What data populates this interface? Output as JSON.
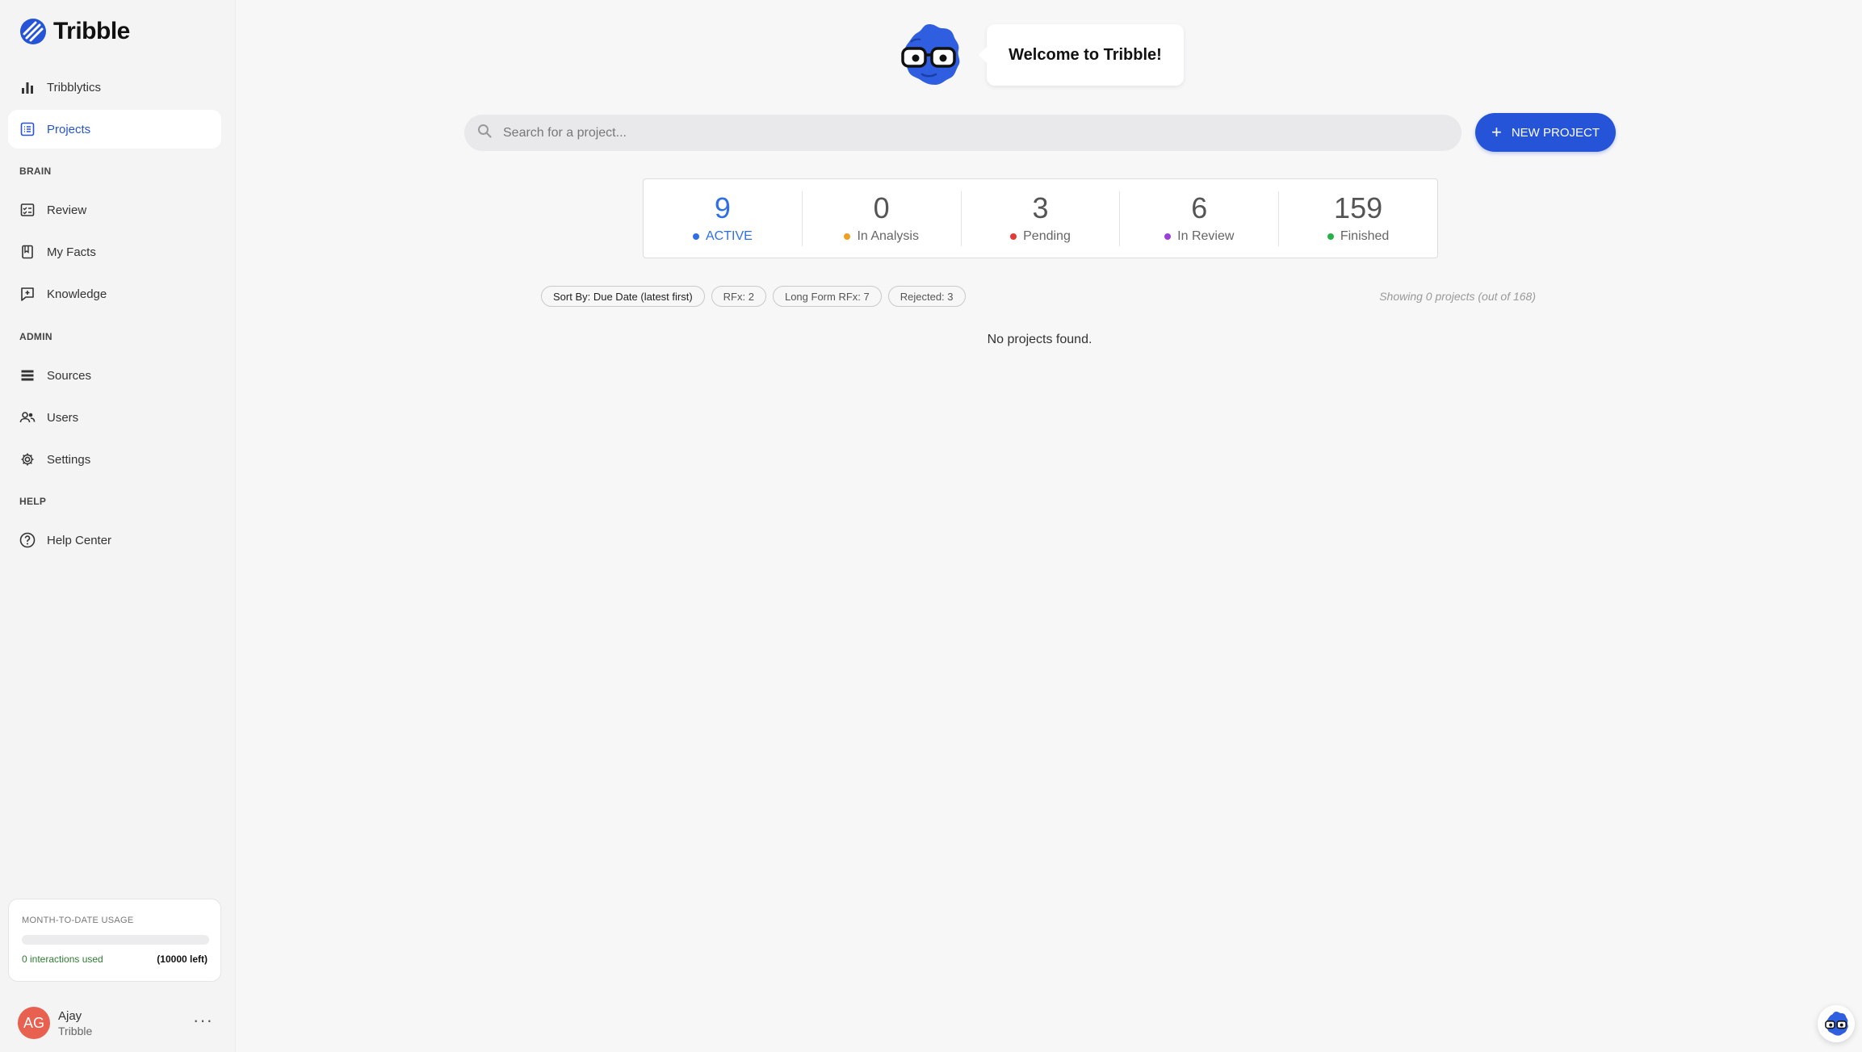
{
  "app": {
    "name": "Tribble"
  },
  "sidebar": {
    "nav_top": [
      {
        "label": "Tribblytics",
        "icon": "bar-chart-icon"
      },
      {
        "label": "Projects",
        "icon": "list-icon",
        "active": true
      }
    ],
    "sections": {
      "brain": "BRAIN",
      "admin": "ADMIN",
      "help": "HELP"
    },
    "brain_items": [
      {
        "label": "Review",
        "icon": "checklist-icon"
      },
      {
        "label": "My Facts",
        "icon": "book-icon"
      },
      {
        "label": "Knowledge",
        "icon": "plus-square-icon"
      }
    ],
    "admin_items": [
      {
        "label": "Sources",
        "icon": "stack-icon"
      },
      {
        "label": "Users",
        "icon": "users-icon"
      },
      {
        "label": "Settings",
        "icon": "gear-icon"
      }
    ],
    "help_items": [
      {
        "label": "Help Center",
        "icon": "help-circle-icon"
      }
    ],
    "usage": {
      "title": "MONTH-TO-DATE USAGE",
      "used_label": "0 interactions used",
      "left_label": "(10000 left)",
      "progress": 0
    },
    "user": {
      "initials": "AG",
      "name": "Ajay",
      "org": "Tribble",
      "more": "···"
    }
  },
  "header": {
    "welcome": "Welcome to Tribble!"
  },
  "search": {
    "placeholder": "Search for a project..."
  },
  "new_project_button": {
    "label": "NEW PROJECT"
  },
  "stats": [
    {
      "value": "9",
      "label": "ACTIVE",
      "color": "#2f6fe6"
    },
    {
      "value": "0",
      "label": "In Analysis",
      "color": "#f0a020"
    },
    {
      "value": "3",
      "label": "Pending",
      "color": "#e53935"
    },
    {
      "value": "6",
      "label": "In Review",
      "color": "#9c3fd9"
    },
    {
      "value": "159",
      "label": "Finished",
      "color": "#27b04a"
    }
  ],
  "filters": {
    "sort": "Sort By: Due Date (latest first)",
    "chips": [
      "RFx: 2",
      "Long Form RFx: 7",
      "Rejected: 3"
    ],
    "showing": "Showing 0 projects (out of 168)"
  },
  "empty_state": "No projects found.",
  "colors": {
    "accent": "#2554d8",
    "usage_green": "#2e7d32",
    "avatar": "#e8604f"
  }
}
